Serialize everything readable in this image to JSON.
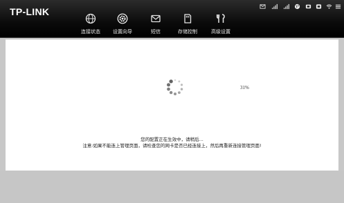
{
  "brand": {
    "logo_text": "TP-LINK"
  },
  "nav": {
    "items": [
      {
        "label": "连接状态",
        "icon": "globe-icon"
      },
      {
        "label": "设置向导",
        "icon": "gear-icon"
      },
      {
        "label": "短信",
        "icon": "envelope-icon"
      },
      {
        "label": "存储控制",
        "icon": "sd-card-icon"
      },
      {
        "label": "高级设置",
        "icon": "tools-icon"
      }
    ]
  },
  "status_bar": {
    "icons": [
      "message-icon",
      "signal-strength-icon-1",
      "signal-strength-icon-2",
      "globe-status-icon",
      "sim-card-icon",
      "battery-icon",
      "wifi-icon",
      "menu-icon"
    ]
  },
  "progress": {
    "percent_text": "31%",
    "value": 0.31
  },
  "messages": {
    "line1": "您的配置正在生效中，请稍后...",
    "line2": "注意:如果不能连上管理页面，请检查您的网卡是否已经连接上，然后再重新连接管理页面!"
  },
  "colors": {
    "topbar": "#0b0b0b",
    "panel": "#ffffff",
    "background": "#c8c8c8",
    "spinner": "#555555"
  }
}
